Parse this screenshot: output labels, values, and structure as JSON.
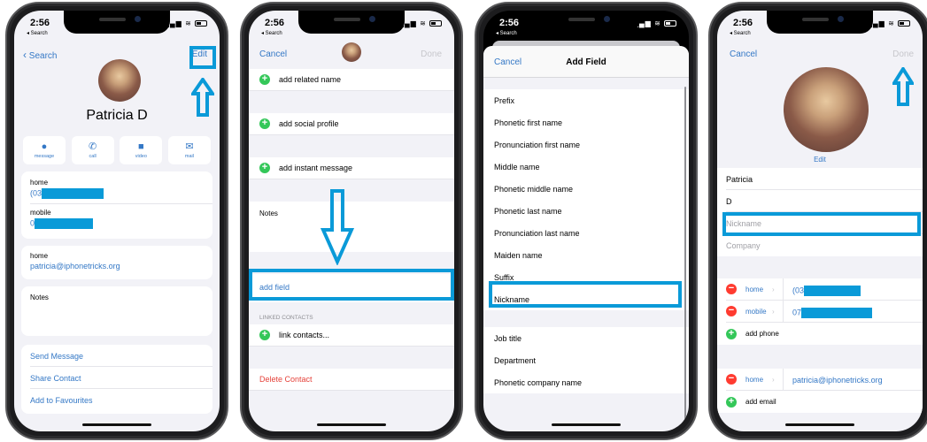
{
  "status_bar": {
    "time": "2:56",
    "back_label": "◂ Search",
    "signal": "▂▄▆",
    "wifi": "≋"
  },
  "colors": {
    "highlight": "#0a9ad8",
    "ios_blue": "#3478c6",
    "green": "#34c759",
    "red": "#ff3b30"
  },
  "phone1": {
    "back_label": "Search",
    "edit_label": "Edit",
    "contact_name": "Patricia D",
    "actions": [
      {
        "icon": "message-icon",
        "glyph": "💬",
        "label": "message"
      },
      {
        "icon": "call-icon",
        "glyph": "✆",
        "label": "call"
      },
      {
        "icon": "video-icon",
        "glyph": "■◂",
        "label": "video"
      },
      {
        "icon": "mail-icon",
        "glyph": "✉",
        "label": "mail"
      }
    ],
    "phones": [
      {
        "label": "home",
        "value_prefix": "(03"
      },
      {
        "label": "mobile",
        "value_prefix": "0"
      }
    ],
    "email": {
      "label": "home",
      "value": "patricia@iphonetricks.org"
    },
    "notes_label": "Notes",
    "links": [
      "Send Message",
      "Share Contact",
      "Add to Favourites"
    ]
  },
  "phone2": {
    "cancel_label": "Cancel",
    "done_label": "Done",
    "add_rows": [
      "add related name",
      "add social profile",
      "add instant message"
    ],
    "notes_label": "Notes",
    "add_field_label": "add field",
    "linked_header": "LINKED CONTACTS",
    "link_contacts_label": "link contacts...",
    "delete_label": "Delete Contact"
  },
  "phone3": {
    "cancel_label": "Cancel",
    "title": "Add Field",
    "group1": [
      "Prefix",
      "Phonetic first name",
      "Pronunciation first name",
      "Middle name",
      "Phonetic middle name",
      "Phonetic last name",
      "Pronunciation last name",
      "Maiden name",
      "Suffix",
      "Nickname"
    ],
    "group2": [
      "Job title",
      "Department",
      "Phonetic company name"
    ],
    "highlighted": "Nickname"
  },
  "phone4": {
    "cancel_label": "Cancel",
    "done_label": "Done",
    "edit_photo_label": "Edit",
    "first_name": "Patricia",
    "last_name": "D",
    "nickname_placeholder": "Nickname",
    "company_placeholder": "Company",
    "phones": [
      {
        "label": "home",
        "value_prefix": "(03"
      },
      {
        "label": "mobile",
        "value_prefix": "07"
      }
    ],
    "add_phone_label": "add phone",
    "email": {
      "label": "home",
      "value": "patricia@iphonetricks.org"
    },
    "add_email_label": "add email"
  }
}
